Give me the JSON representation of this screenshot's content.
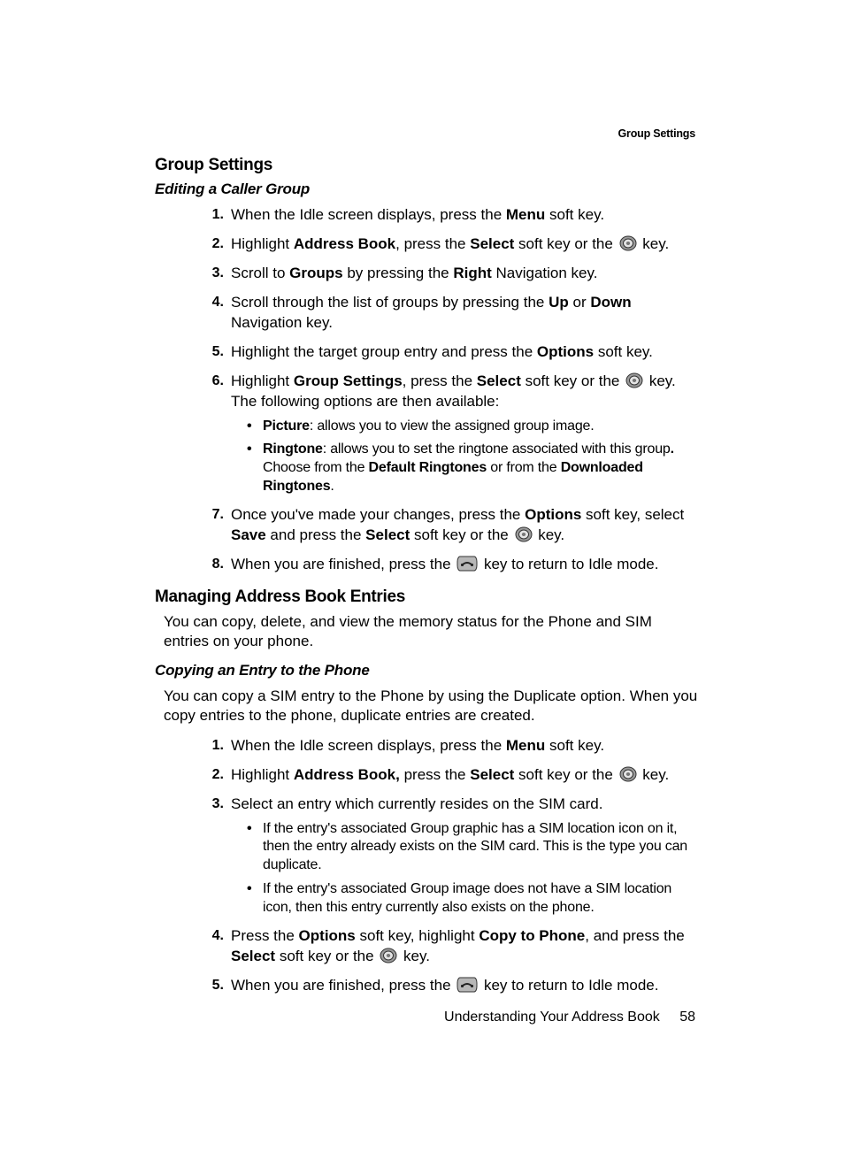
{
  "running_header": "Group Settings",
  "h2_group_settings": "Group Settings",
  "h3_editing": "Editing a Caller Group",
  "steps_a": {
    "s1": {
      "num": "1.",
      "pre": "When the Idle screen displays, press the ",
      "b1": "Menu",
      "post": " soft key."
    },
    "s2": {
      "num": "2.",
      "t1": "Highlight ",
      "b1": "Address Book",
      "t2": ", press the ",
      "b2": "Select",
      "t3": " soft key or the ",
      "t4": " key."
    },
    "s3": {
      "num": "3.",
      "t1": "Scroll to ",
      "b1": "Groups",
      "t2": " by pressing the ",
      "b2": "Right",
      "t3": " Navigation key."
    },
    "s4": {
      "num": "4.",
      "t1": "Scroll through the list of groups by pressing the ",
      "b1": "Up",
      "t2": " or ",
      "b2": "Down",
      "t3": " Navigation key."
    },
    "s5": {
      "num": "5.",
      "t1": "Highlight the target group entry and press the ",
      "b1": "Options",
      "t2": " soft key."
    },
    "s6": {
      "num": "6.",
      "t1": "Highlight ",
      "b1": "Group Settings",
      "t2": ", press the ",
      "b2": "Select",
      "t3": " soft key or the ",
      "t4": " key. The following options are then available:"
    },
    "s6_sub": {
      "a": {
        "b": "Picture",
        "t": ": allows you to view the assigned group image."
      },
      "b": {
        "b": "Ringtone",
        "t1": ": allows you to set the ringtone associated with this group",
        "dot": ".",
        "t2": " Choose from the ",
        "b2": "Default Ringtones",
        "t3": " or from the ",
        "b3": "Downloaded Ringtones",
        "t4": "."
      }
    },
    "s7": {
      "num": "7.",
      "t1": "Once you've made your changes, press the ",
      "b1": "Options",
      "t2": " soft key, select ",
      "b2": "Save",
      "t3": " and press the ",
      "b3": "Select",
      "t4": " soft key or the ",
      "t5": " key."
    },
    "s8": {
      "num": "8.",
      "t1": "When you are finished, press the ",
      "t2": " key to return to Idle mode."
    }
  },
  "h2_managing": "Managing Address Book Entries",
  "para_managing": "You can copy, delete, and view the memory status for the Phone and SIM entries on your phone.",
  "h3_copying": "Copying an Entry to the Phone",
  "para_copying": "You can copy a SIM entry to the Phone by using the Duplicate option. When you copy entries to the phone, duplicate entries are created.",
  "steps_b": {
    "s1": {
      "num": "1.",
      "t1": "When the Idle screen displays, press the ",
      "b1": "Menu",
      "t2": " soft key."
    },
    "s2": {
      "num": "2.",
      "t1": "Highlight ",
      "b1": "Address Book,",
      "t2": " press the ",
      "b2": "Select",
      "t3": " soft key or the ",
      "t4": " key."
    },
    "s3": {
      "num": "3.",
      "t1": "Select an entry which currently resides on the SIM card."
    },
    "s3_sub": {
      "a": "If the entry's associated Group graphic has a SIM location icon on it, then the entry already exists on the SIM card. This is the type you can duplicate.",
      "b": "If the entry's associated Group image does not have a SIM location icon, then this entry currently also exists on the phone."
    },
    "s4": {
      "num": "4.",
      "t1": "Press the ",
      "b1": "Options",
      "t2": " soft key, highlight ",
      "b2": "Copy to Phone",
      "t3": ", and press the ",
      "b3": "Select",
      "t4": " soft key or the ",
      "t5": " key."
    },
    "s5": {
      "num": "5.",
      "t1": "When you are finished, press the ",
      "t2": " key to return to Idle mode."
    }
  },
  "footer_text": "Understanding Your Address Book",
  "page_number": "58"
}
